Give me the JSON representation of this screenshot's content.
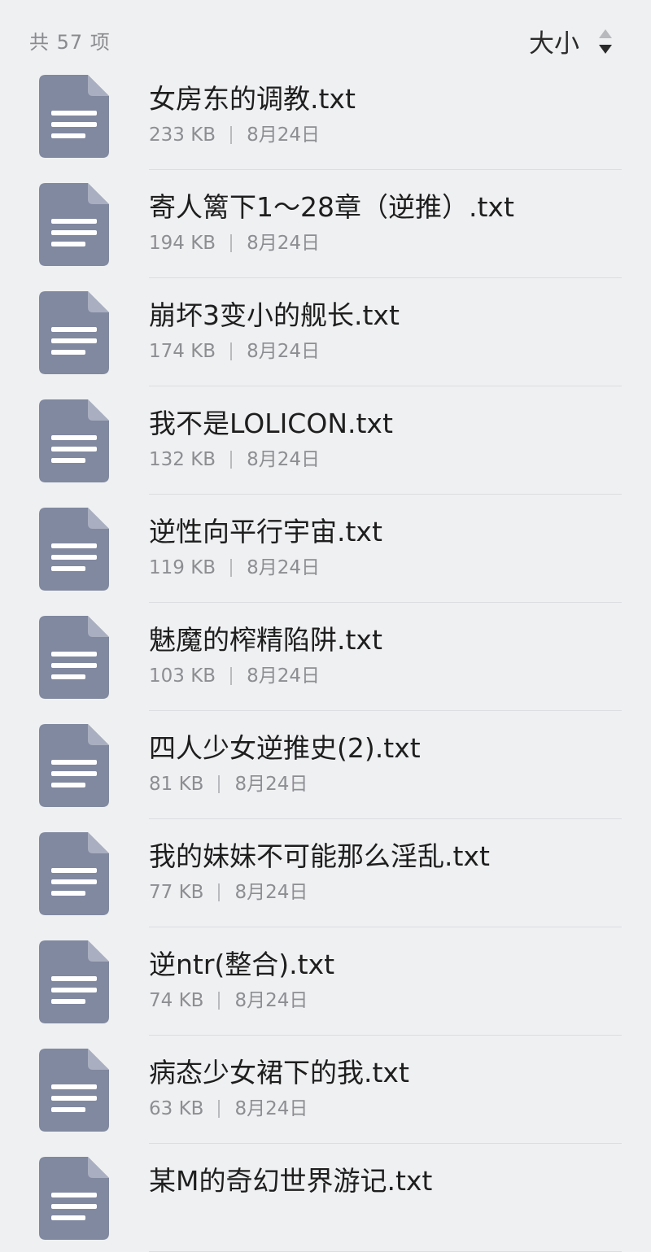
{
  "header": {
    "count_label": "共 57 项",
    "sort_label": "大小"
  },
  "icon_color": "#8189a0",
  "files": [
    {
      "name": "女房东的调教.txt",
      "size": "233 KB",
      "date": "8月24日",
      "icon": "text-file-icon"
    },
    {
      "name": "寄人篱下1～28章（逆推）.txt",
      "size": "194 KB",
      "date": "8月24日",
      "icon": "text-file-icon"
    },
    {
      "name": "崩坏3变小的舰长.txt",
      "size": "174 KB",
      "date": "8月24日",
      "icon": "text-file-icon"
    },
    {
      "name": "我不是LOLICON.txt",
      "size": "132 KB",
      "date": "8月24日",
      "icon": "text-file-icon"
    },
    {
      "name": "逆性向平行宇宙.txt",
      "size": "119 KB",
      "date": "8月24日",
      "icon": "text-file-icon"
    },
    {
      "name": "魅魔的榨精陷阱.txt",
      "size": "103 KB",
      "date": "8月24日",
      "icon": "text-file-icon"
    },
    {
      "name": "四人少女逆推史(2).txt",
      "size": "81 KB",
      "date": "8月24日",
      "icon": "text-file-icon"
    },
    {
      "name": "我的妹妹不可能那么淫乱.txt",
      "size": "77 KB",
      "date": "8月24日",
      "icon": "text-file-icon"
    },
    {
      "name": "逆ntr(整合).txt",
      "size": "74 KB",
      "date": "8月24日",
      "icon": "text-file-icon"
    },
    {
      "name": "病态少女裙下的我.txt",
      "size": "63 KB",
      "date": "8月24日",
      "icon": "text-file-icon"
    },
    {
      "name": "某M的奇幻世界游记.txt",
      "size": "",
      "date": "",
      "icon": "text-file-icon"
    }
  ]
}
